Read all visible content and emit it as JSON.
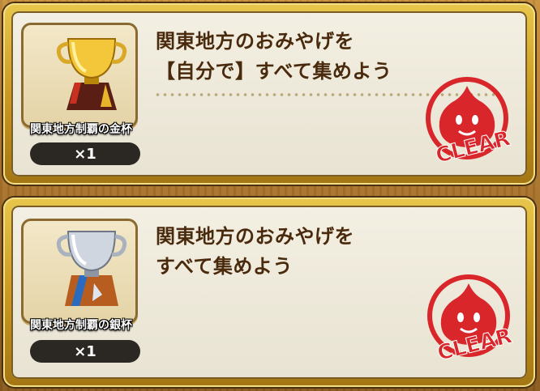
{
  "missions": [
    {
      "reward_name": "関東地方制覇の金杯",
      "reward_count": "×1",
      "description_line1": "関東地方のおみやげを",
      "description_line2": "【自分で】すべて集めよう",
      "status": "CLEAR",
      "trophy_icon": "gold-trophy-icon"
    },
    {
      "reward_name": "関東地方制覇の銀杯",
      "reward_count": "×1",
      "description_line1": "関東地方のおみやげを",
      "description_line2": "すべて集めよう",
      "status": "CLEAR",
      "trophy_icon": "silver-trophy-icon"
    }
  ],
  "colors": {
    "stamp_red": "#d8262b",
    "card_gold": "#d6a62c",
    "text_brown": "#4a2a0c"
  }
}
